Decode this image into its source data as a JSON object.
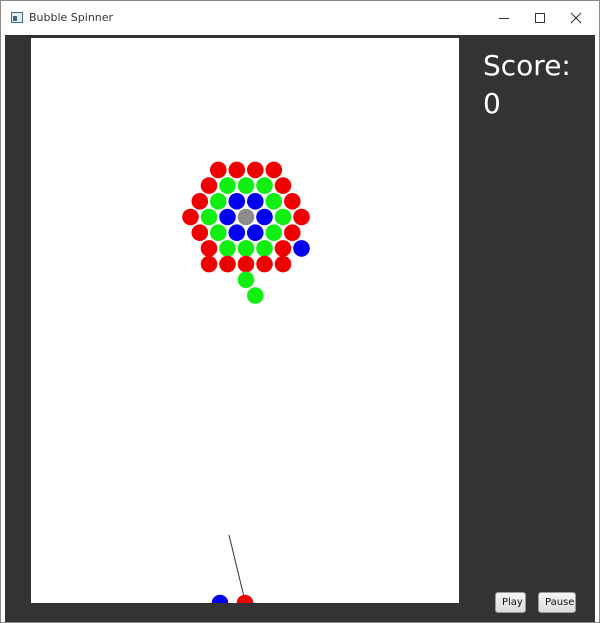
{
  "window": {
    "title": "Bubble Spinner"
  },
  "sidebar": {
    "score_label": "Score:",
    "score_value": "0"
  },
  "controls": {
    "play_label": "Play",
    "pause_label": "Pause"
  },
  "colors": {
    "red": "#ee0000",
    "green": "#11ee11",
    "blue": "#0000ee",
    "gray": "#8c8c8c",
    "panel": "#333333",
    "field": "#ffffff"
  },
  "cluster_center_color": "gray",
  "cluster_bubbles": [
    [
      "red",
      "red",
      "red",
      "red"
    ],
    [
      "red",
      "green",
      "green",
      "green",
      "red"
    ],
    [
      "red",
      "green",
      "blue",
      "blue",
      "green",
      "red"
    ],
    [
      "red",
      "green",
      "blue",
      "gray",
      "blue",
      "green",
      "red"
    ],
    [
      "red",
      "green",
      "blue",
      "blue",
      "green",
      "red"
    ],
    [
      "red",
      "green",
      "green",
      "green",
      "red",
      "blue"
    ],
    [
      "red",
      "red",
      "red",
      "red",
      "red"
    ]
  ],
  "hanging_bubbles": [
    "green",
    "green"
  ],
  "shooter": {
    "next_bubble": "blue",
    "loaded_bubble": "red"
  }
}
